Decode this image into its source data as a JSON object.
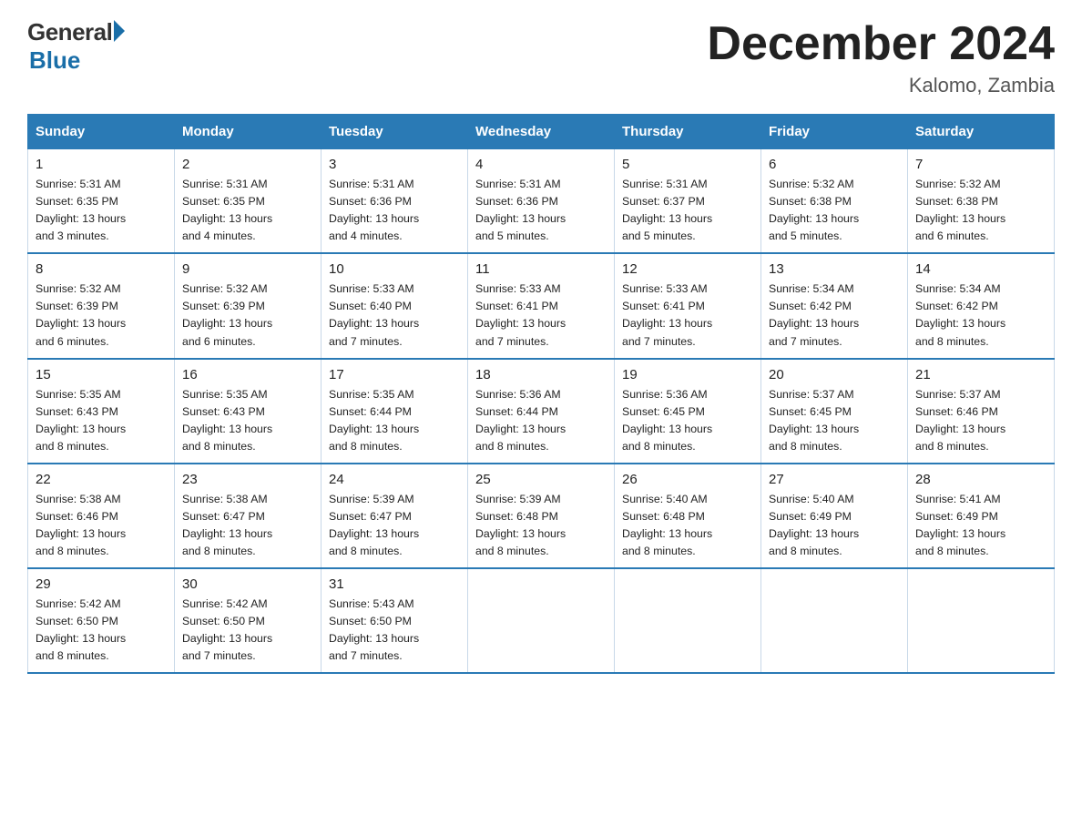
{
  "header": {
    "logo_general": "General",
    "logo_blue": "Blue",
    "month_title": "December 2024",
    "location": "Kalomo, Zambia"
  },
  "days_of_week": [
    "Sunday",
    "Monday",
    "Tuesday",
    "Wednesday",
    "Thursday",
    "Friday",
    "Saturday"
  ],
  "weeks": [
    [
      {
        "day": "1",
        "sunrise": "5:31 AM",
        "sunset": "6:35 PM",
        "daylight": "13 hours and 3 minutes."
      },
      {
        "day": "2",
        "sunrise": "5:31 AM",
        "sunset": "6:35 PM",
        "daylight": "13 hours and 4 minutes."
      },
      {
        "day": "3",
        "sunrise": "5:31 AM",
        "sunset": "6:36 PM",
        "daylight": "13 hours and 4 minutes."
      },
      {
        "day": "4",
        "sunrise": "5:31 AM",
        "sunset": "6:36 PM",
        "daylight": "13 hours and 5 minutes."
      },
      {
        "day": "5",
        "sunrise": "5:31 AM",
        "sunset": "6:37 PM",
        "daylight": "13 hours and 5 minutes."
      },
      {
        "day": "6",
        "sunrise": "5:32 AM",
        "sunset": "6:38 PM",
        "daylight": "13 hours and 5 minutes."
      },
      {
        "day": "7",
        "sunrise": "5:32 AM",
        "sunset": "6:38 PM",
        "daylight": "13 hours and 6 minutes."
      }
    ],
    [
      {
        "day": "8",
        "sunrise": "5:32 AM",
        "sunset": "6:39 PM",
        "daylight": "13 hours and 6 minutes."
      },
      {
        "day": "9",
        "sunrise": "5:32 AM",
        "sunset": "6:39 PM",
        "daylight": "13 hours and 6 minutes."
      },
      {
        "day": "10",
        "sunrise": "5:33 AM",
        "sunset": "6:40 PM",
        "daylight": "13 hours and 7 minutes."
      },
      {
        "day": "11",
        "sunrise": "5:33 AM",
        "sunset": "6:41 PM",
        "daylight": "13 hours and 7 minutes."
      },
      {
        "day": "12",
        "sunrise": "5:33 AM",
        "sunset": "6:41 PM",
        "daylight": "13 hours and 7 minutes."
      },
      {
        "day": "13",
        "sunrise": "5:34 AM",
        "sunset": "6:42 PM",
        "daylight": "13 hours and 7 minutes."
      },
      {
        "day": "14",
        "sunrise": "5:34 AM",
        "sunset": "6:42 PM",
        "daylight": "13 hours and 8 minutes."
      }
    ],
    [
      {
        "day": "15",
        "sunrise": "5:35 AM",
        "sunset": "6:43 PM",
        "daylight": "13 hours and 8 minutes."
      },
      {
        "day": "16",
        "sunrise": "5:35 AM",
        "sunset": "6:43 PM",
        "daylight": "13 hours and 8 minutes."
      },
      {
        "day": "17",
        "sunrise": "5:35 AM",
        "sunset": "6:44 PM",
        "daylight": "13 hours and 8 minutes."
      },
      {
        "day": "18",
        "sunrise": "5:36 AM",
        "sunset": "6:44 PM",
        "daylight": "13 hours and 8 minutes."
      },
      {
        "day": "19",
        "sunrise": "5:36 AM",
        "sunset": "6:45 PM",
        "daylight": "13 hours and 8 minutes."
      },
      {
        "day": "20",
        "sunrise": "5:37 AM",
        "sunset": "6:45 PM",
        "daylight": "13 hours and 8 minutes."
      },
      {
        "day": "21",
        "sunrise": "5:37 AM",
        "sunset": "6:46 PM",
        "daylight": "13 hours and 8 minutes."
      }
    ],
    [
      {
        "day": "22",
        "sunrise": "5:38 AM",
        "sunset": "6:46 PM",
        "daylight": "13 hours and 8 minutes."
      },
      {
        "day": "23",
        "sunrise": "5:38 AM",
        "sunset": "6:47 PM",
        "daylight": "13 hours and 8 minutes."
      },
      {
        "day": "24",
        "sunrise": "5:39 AM",
        "sunset": "6:47 PM",
        "daylight": "13 hours and 8 minutes."
      },
      {
        "day": "25",
        "sunrise": "5:39 AM",
        "sunset": "6:48 PM",
        "daylight": "13 hours and 8 minutes."
      },
      {
        "day": "26",
        "sunrise": "5:40 AM",
        "sunset": "6:48 PM",
        "daylight": "13 hours and 8 minutes."
      },
      {
        "day": "27",
        "sunrise": "5:40 AM",
        "sunset": "6:49 PM",
        "daylight": "13 hours and 8 minutes."
      },
      {
        "day": "28",
        "sunrise": "5:41 AM",
        "sunset": "6:49 PM",
        "daylight": "13 hours and 8 minutes."
      }
    ],
    [
      {
        "day": "29",
        "sunrise": "5:42 AM",
        "sunset": "6:50 PM",
        "daylight": "13 hours and 8 minutes."
      },
      {
        "day": "30",
        "sunrise": "5:42 AM",
        "sunset": "6:50 PM",
        "daylight": "13 hours and 7 minutes."
      },
      {
        "day": "31",
        "sunrise": "5:43 AM",
        "sunset": "6:50 PM",
        "daylight": "13 hours and 7 minutes."
      },
      null,
      null,
      null,
      null
    ]
  ],
  "labels": {
    "sunrise": "Sunrise:",
    "sunset": "Sunset:",
    "daylight": "Daylight:"
  }
}
